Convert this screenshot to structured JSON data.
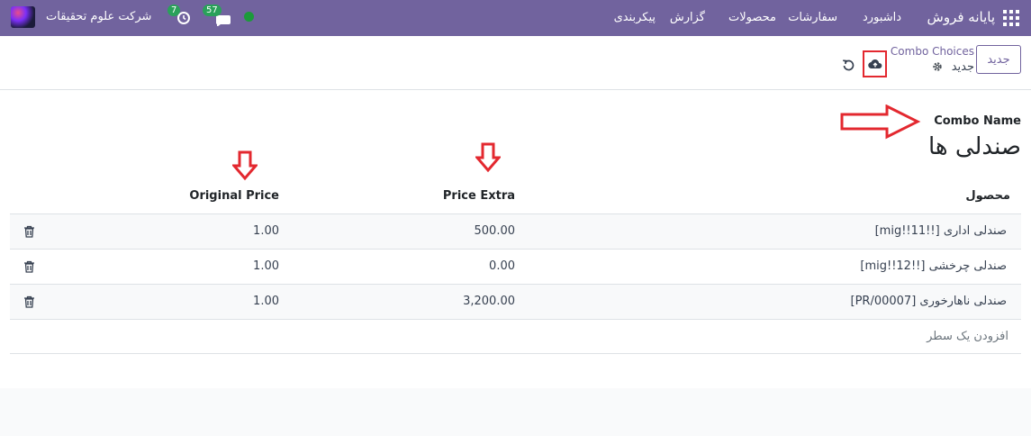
{
  "navbar": {
    "app_name": "پایانه فروش",
    "menu": [
      "داشبورد",
      "سفارشات",
      "محصولات",
      "گزارش",
      "پیکربندی"
    ],
    "company": "شرکت علوم تحقیقات",
    "activity_count": "7",
    "message_count": "57",
    "presence_color": "#1c9a3a",
    "brand_color": "#71639e"
  },
  "control": {
    "new_button": "جدید",
    "breadcrumb_parent": "Combo Choices",
    "record_name": "جدید",
    "gear_icon": "gear-icon",
    "save_icon": "cloud-upload-icon",
    "discard_icon": "undo-icon"
  },
  "form": {
    "field_label": "Combo Name",
    "combo_name": "صندلی ها"
  },
  "table": {
    "columns": [
      "محصول",
      "Price Extra",
      "Original Price"
    ],
    "rows": [
      {
        "product": "[mig!!11!!] صندلی اداری",
        "price_extra": "500.00",
        "original_price": "1.00"
      },
      {
        "product": "[mig!!12!!] صندلی چرخشی",
        "price_extra": "0.00",
        "original_price": "1.00"
      },
      {
        "product": "[PR/00007] صندلی ناهارخوری",
        "price_extra": "3,200.00",
        "original_price": "1.00"
      }
    ],
    "add_line": "افزودن یک سطر"
  },
  "annotations": {
    "highlight_color": "#e3282f"
  }
}
